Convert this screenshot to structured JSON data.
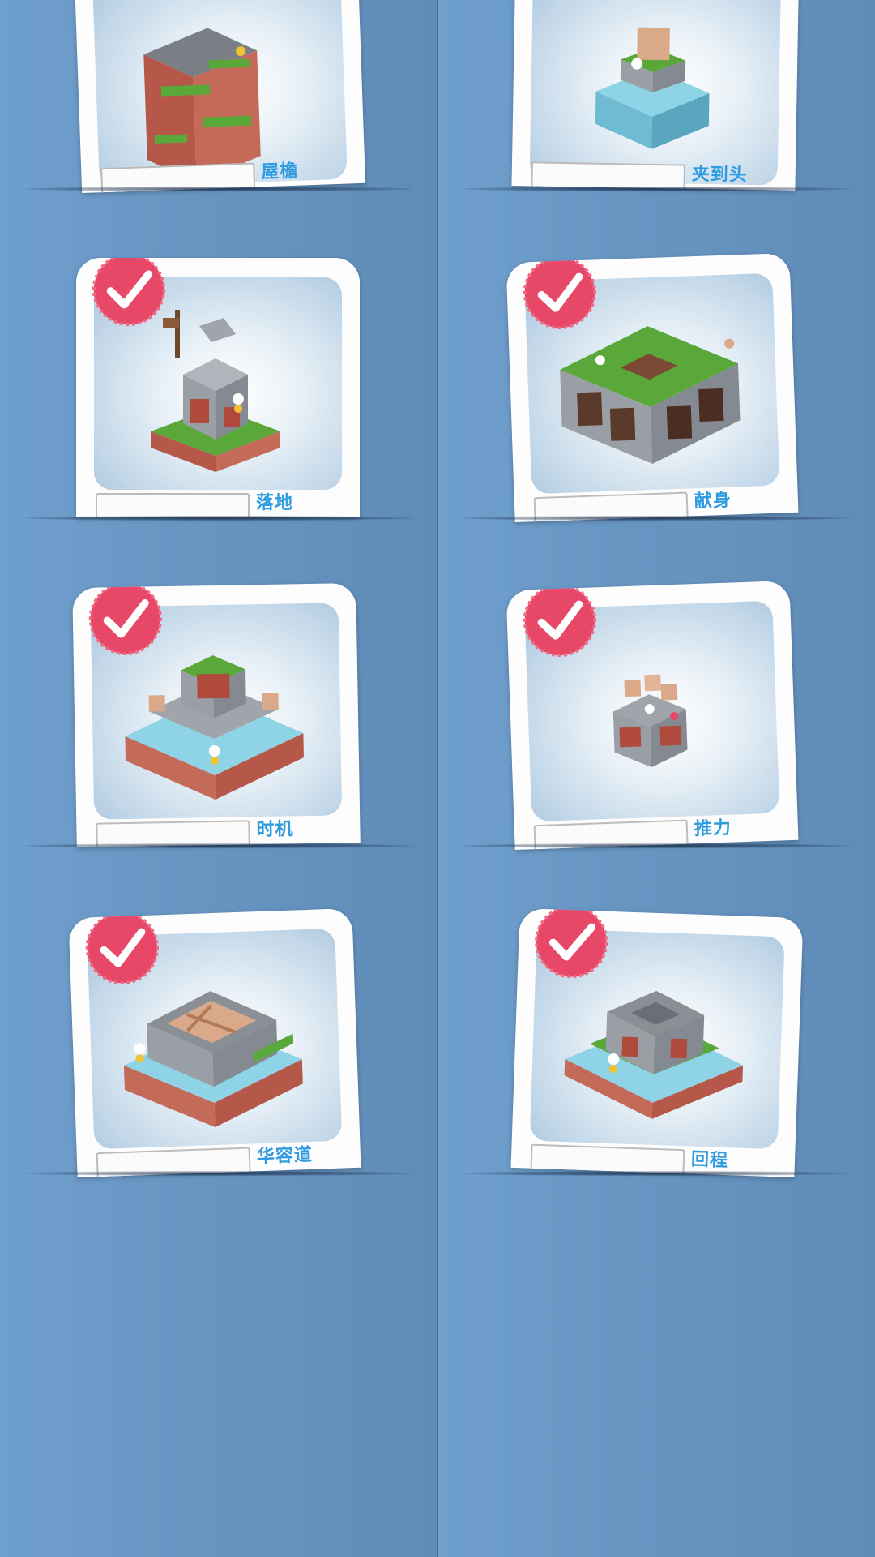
{
  "levels": [
    {
      "title": "屋檐",
      "completed": false
    },
    {
      "title": "夹到头",
      "completed": false
    },
    {
      "title": "落地",
      "completed": true
    },
    {
      "title": "献身",
      "completed": true
    },
    {
      "title": "时机",
      "completed": true
    },
    {
      "title": "推力",
      "completed": true
    },
    {
      "title": "华容道",
      "completed": true
    },
    {
      "title": "回程",
      "completed": true
    }
  ],
  "colors": {
    "background": "#6a98c6",
    "card": "#fdfdfd",
    "label": "#2f9be0",
    "badge": "#e84867",
    "grass": "#5aa83a",
    "brick": "#b04a3c",
    "stone": "#9a9fa6",
    "water": "#8fd3e6"
  },
  "icons": {
    "badge": "checkmark-seal-icon"
  }
}
